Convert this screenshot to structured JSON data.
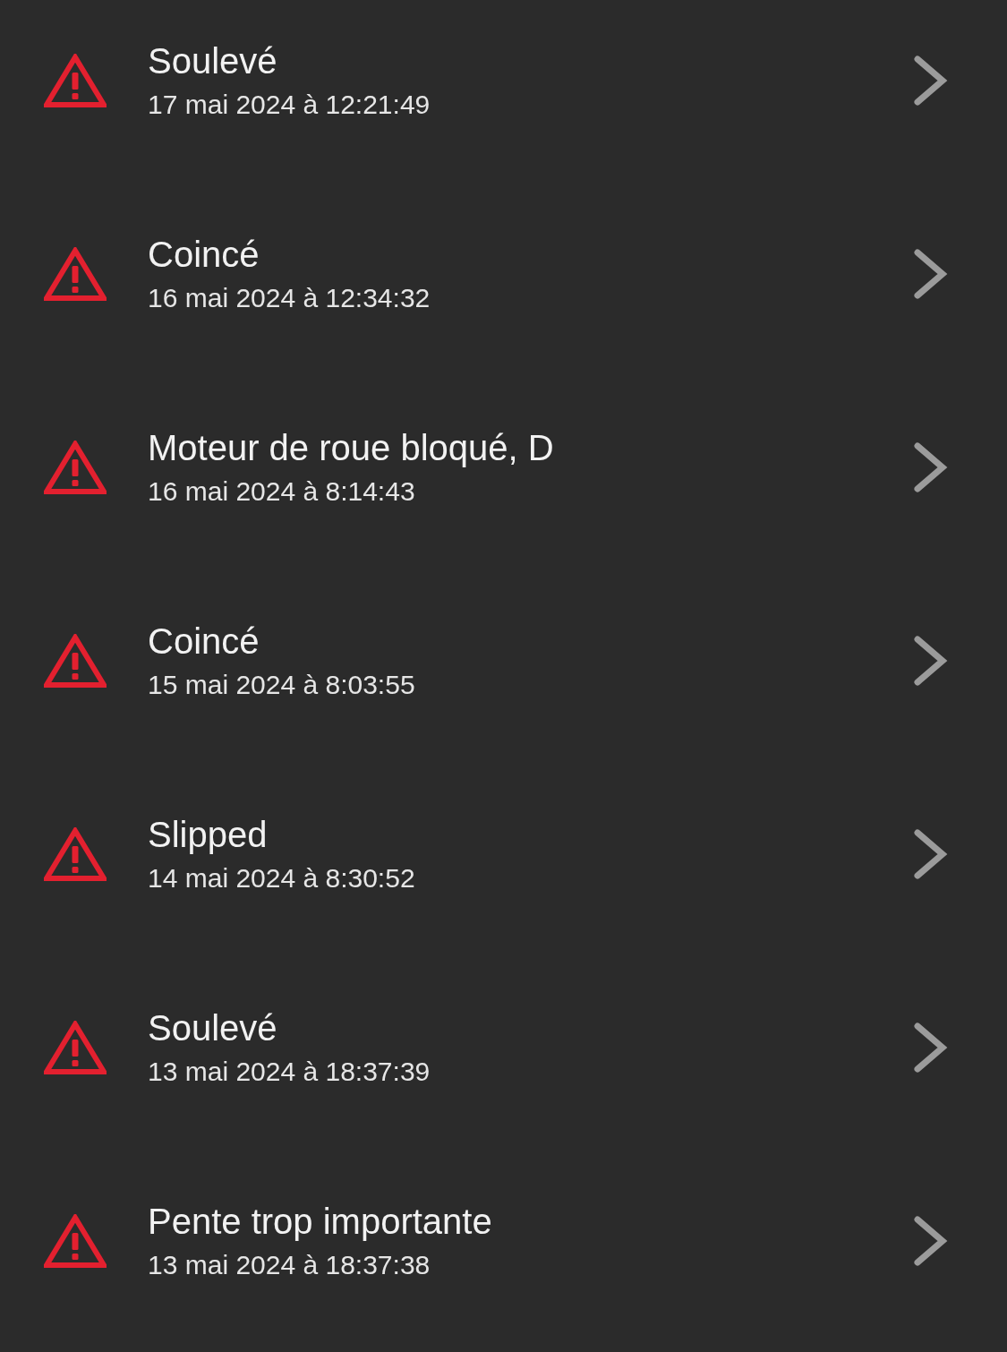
{
  "events": [
    {
      "title": "Soulevé",
      "date": "17 mai 2024 à 12:21:49"
    },
    {
      "title": "Coincé",
      "date": "16 mai 2024 à 12:34:32"
    },
    {
      "title": "Moteur de roue bloqué, D",
      "date": "16 mai 2024 à 8:14:43"
    },
    {
      "title": "Coincé",
      "date": "15 mai 2024 à 8:03:55"
    },
    {
      "title": "Slipped",
      "date": "14 mai 2024 à 8:30:52"
    },
    {
      "title": "Soulevé",
      "date": "13 mai 2024 à 18:37:39"
    },
    {
      "title": "Pente trop importante",
      "date": "13 mai 2024 à 18:37:38"
    }
  ]
}
